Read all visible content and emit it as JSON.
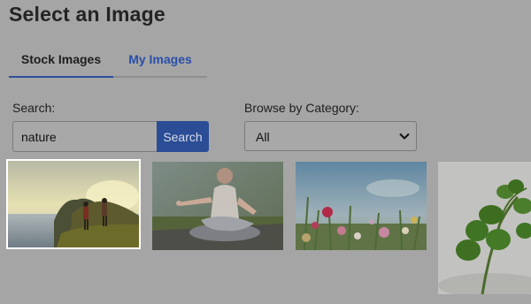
{
  "page": {
    "title": "Select an Image"
  },
  "tabs": [
    {
      "label": "Stock Images",
      "active": true
    },
    {
      "label": "My Images",
      "active": false
    }
  ],
  "search": {
    "label": "Search:",
    "value": "nature",
    "button_label": "Search"
  },
  "category": {
    "label": "Browse by Category:",
    "selected": "All"
  },
  "images": [
    {
      "icon": "hikers-coast-photo",
      "selected": true
    },
    {
      "icon": "yoga-meditation-photo",
      "selected": false
    },
    {
      "icon": "wildflowers-photo",
      "selected": false
    },
    {
      "icon": "clover-photo",
      "selected": false
    }
  ],
  "colors": {
    "accent": "#2a4d96",
    "background": "#a5a5a5",
    "link": "#2a4fa8"
  }
}
